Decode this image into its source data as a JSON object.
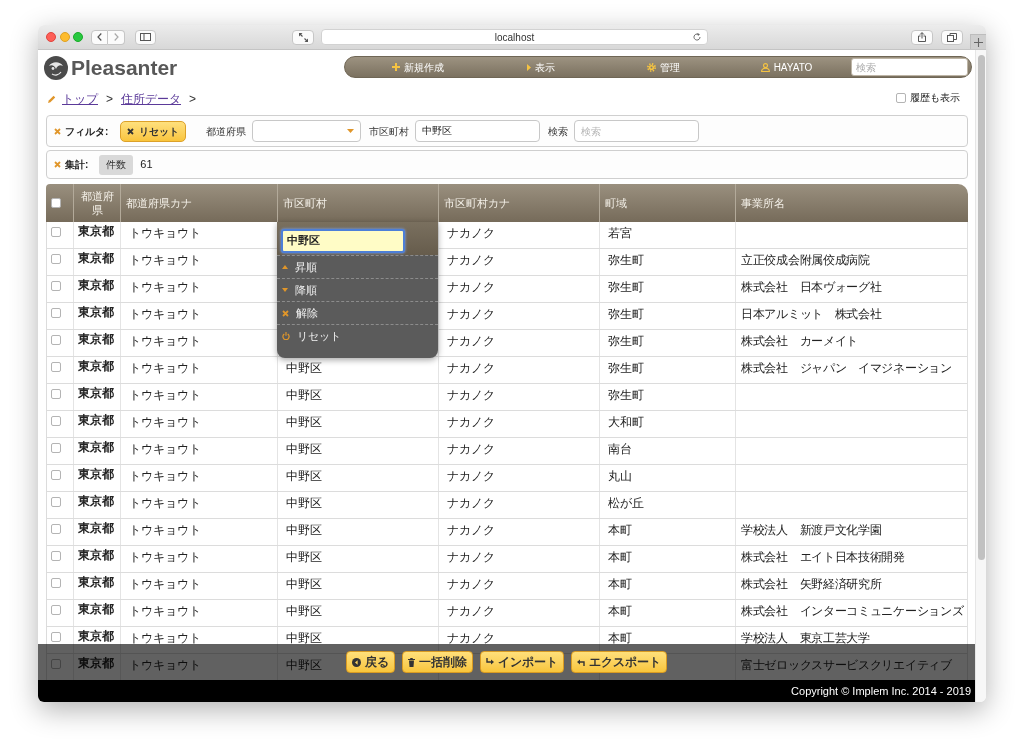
{
  "browser": {
    "address": "localhost"
  },
  "header": {
    "logo": "Pleasanter",
    "nav": [
      {
        "kind": "new",
        "label": "新規作成"
      },
      {
        "kind": "view",
        "label": "表示"
      },
      {
        "kind": "manage",
        "label": "管理"
      },
      {
        "kind": "user",
        "label": "HAYATO"
      }
    ],
    "search": {
      "placeholder": "検索"
    }
  },
  "breadcrumb": [
    {
      "label": "トップ",
      "separator": ">"
    },
    {
      "label": "住所データ",
      "separator": ">"
    }
  ],
  "history_toggle": {
    "label": "履歴も表示",
    "checked": false
  },
  "filter": {
    "title": "フィルタ:",
    "reset_button": "リセット",
    "fields": [
      {
        "kind": "select",
        "label": "都道府県"
      },
      {
        "kind": "text",
        "label": "市区町村",
        "value": "中野区"
      },
      {
        "kind": "text",
        "label": "検索",
        "placeholder": "検索"
      }
    ]
  },
  "aggregation": {
    "title": "集計:",
    "items": [
      {
        "label": "件数",
        "value": "61"
      }
    ]
  },
  "table": {
    "select_all_checked": false,
    "columns": [
      {
        "label": "都道府県"
      },
      {
        "label": "都道府県カナ"
      },
      {
        "label": "市区町村",
        "filter_menu": {
          "value": "中野区",
          "focused": true,
          "items": [
            {
              "kind": "asc",
              "label": "昇順"
            },
            {
              "kind": "desc",
              "label": "降順"
            },
            {
              "kind": "clear",
              "label": "解除"
            },
            {
              "kind": "reset",
              "label": "リセット"
            }
          ]
        }
      },
      {
        "label": "市区町村カナ"
      },
      {
        "label": "町域"
      },
      {
        "label": "事業所名"
      }
    ],
    "rows": [
      {
        "checked": false,
        "prefecture": "東京都",
        "prefecture_kana": "トウキョウト",
        "city_kana": "ナカノク",
        "town": "若宮"
      },
      {
        "checked": false,
        "prefecture": "東京都",
        "prefecture_kana": "トウキョウト",
        "city_kana": "ナカノク",
        "town": "弥生町",
        "office": "立正佼成会附属佼成病院"
      },
      {
        "checked": false,
        "prefecture": "東京都",
        "prefecture_kana": "トウキョウト",
        "city_kana": "ナカノク",
        "town": "弥生町",
        "office": "株式会社　日本ヴォーグ社"
      },
      {
        "checked": false,
        "prefecture": "東京都",
        "prefecture_kana": "トウキョウト",
        "city_kana": "ナカノク",
        "town": "弥生町",
        "office": "日本アルミット　株式会社"
      },
      {
        "checked": false,
        "prefecture": "東京都",
        "prefecture_kana": "トウキョウト",
        "city_kana": "ナカノク",
        "town": "弥生町",
        "office": "株式会社　カーメイト"
      },
      {
        "checked": false,
        "prefecture": "東京都",
        "prefecture_kana": "トウキョウト",
        "city": "中野区",
        "city_kana": "ナカノク",
        "town": "弥生町",
        "office": "株式会社　ジャパン　イマジネーション"
      },
      {
        "checked": false,
        "prefecture": "東京都",
        "prefecture_kana": "トウキョウト",
        "city": "中野区",
        "city_kana": "ナカノク",
        "town": "弥生町"
      },
      {
        "checked": false,
        "prefecture": "東京都",
        "prefecture_kana": "トウキョウト",
        "city": "中野区",
        "city_kana": "ナカノク",
        "town": "大和町"
      },
      {
        "checked": false,
        "prefecture": "東京都",
        "prefecture_kana": "トウキョウト",
        "city": "中野区",
        "city_kana": "ナカノク",
        "town": "南台"
      },
      {
        "checked": false,
        "prefecture": "東京都",
        "prefecture_kana": "トウキョウト",
        "city": "中野区",
        "city_kana": "ナカノク",
        "town": "丸山"
      },
      {
        "checked": false,
        "prefecture": "東京都",
        "prefecture_kana": "トウキョウト",
        "city": "中野区",
        "city_kana": "ナカノク",
        "town": "松が丘"
      },
      {
        "checked": false,
        "prefecture": "東京都",
        "prefecture_kana": "トウキョウト",
        "city": "中野区",
        "city_kana": "ナカノク",
        "town": "本町",
        "office": "学校法人　新渡戸文化学園"
      },
      {
        "checked": false,
        "prefecture": "東京都",
        "prefecture_kana": "トウキョウト",
        "city": "中野区",
        "city_kana": "ナカノク",
        "town": "本町",
        "office": "株式会社　エイト日本技術開発"
      },
      {
        "checked": false,
        "prefecture": "東京都",
        "prefecture_kana": "トウキョウト",
        "city": "中野区",
        "city_kana": "ナカノク",
        "town": "本町",
        "office": "株式会社　矢野経済研究所"
      },
      {
        "checked": false,
        "prefecture": "東京都",
        "prefecture_kana": "トウキョウト",
        "city": "中野区",
        "city_kana": "ナカノク",
        "town": "本町",
        "office": "株式会社　インターコミュニケーションズ"
      },
      {
        "checked": false,
        "prefecture": "東京都",
        "prefecture_kana": "トウキョウト",
        "city": "中野区",
        "city_kana": "ナカノク",
        "town": "本町",
        "office": "学校法人　東京工芸大学"
      },
      {
        "checked": false,
        "prefecture": "東京都",
        "prefecture_kana": "トウキョウト",
        "city": "中野区",
        "office": "富士ゼロックスサービスクリエイティブ"
      }
    ]
  },
  "actions": [
    {
      "kind": "back",
      "label": "戻る"
    },
    {
      "kind": "bulk_delete",
      "label": "一括削除"
    },
    {
      "kind": "import",
      "label": "インポート"
    },
    {
      "kind": "export",
      "label": "エクスポート"
    }
  ],
  "footer": {
    "copyright": "Copyright © Implem Inc. 2014 - 2019"
  }
}
